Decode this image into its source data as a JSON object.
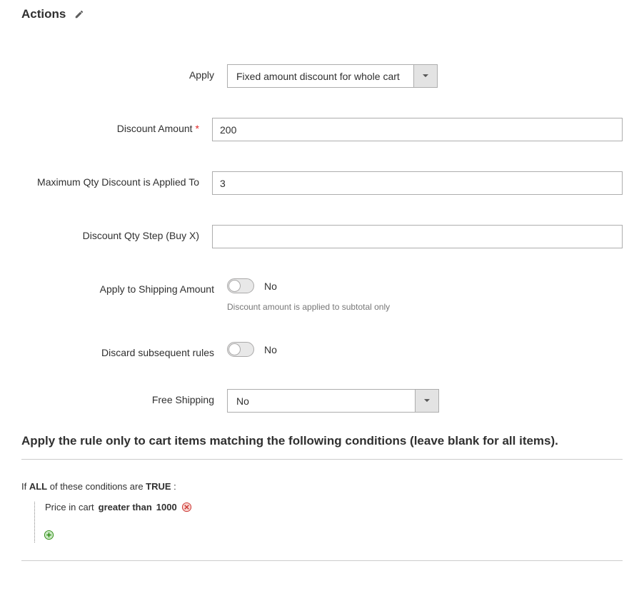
{
  "section": {
    "title": "Actions"
  },
  "form": {
    "apply": {
      "label": "Apply",
      "value": "Fixed amount discount for whole cart"
    },
    "discount_amount": {
      "label": "Discount Amount",
      "value": "200"
    },
    "max_qty": {
      "label": "Maximum Qty Discount is Applied To",
      "value": "3"
    },
    "discount_qty_step": {
      "label": "Discount Qty Step (Buy X)",
      "value": ""
    },
    "apply_shipping": {
      "label": "Apply to Shipping Amount",
      "helper": "Discount amount is applied to subtotal only",
      "value_text": "No"
    },
    "discard_rules": {
      "label": "Discard subsequent rules",
      "value_text": "No"
    },
    "free_shipping": {
      "label": "Free Shipping",
      "value": "No"
    }
  },
  "conditions": {
    "heading": "Apply the rule only to cart items matching the following conditions (leave blank for all items).",
    "prefix": "If ",
    "aggregator": "ALL",
    "middle": " of these conditions are ",
    "bool": "TRUE",
    "suffix": " :",
    "rule": {
      "attribute": "Price in cart",
      "operator": "greater than",
      "value": "1000"
    }
  }
}
